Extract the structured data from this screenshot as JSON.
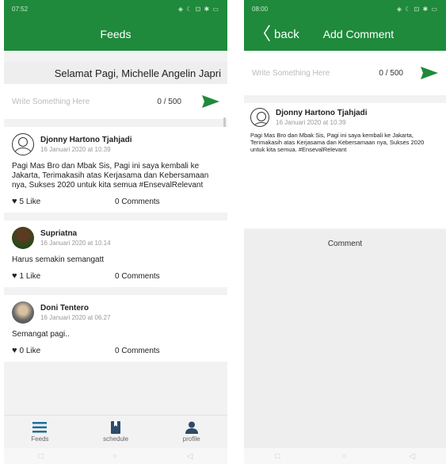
{
  "left": {
    "status_time": "07:52",
    "status_right": "◈ ☾ ⊡ ✱ ▭",
    "title": "Feeds",
    "greeting": "Selamat Pagi, Michelle Angelin Japri",
    "composer": {
      "placeholder": "Write Something Here",
      "count": "0 / 500"
    },
    "posts": [
      {
        "name": "Djonny Hartono Tjahjadi",
        "date": "16 Januari 2020 at 10.39",
        "body": "Pagi Mas Bro dan Mbak Sis, Pagi ini saya kembali ke Jakarta, Terimakasih atas Kerjasama dan Kebersamaan nya, Sukses 2020 untuk kita semua #EnsevalRelevant",
        "likes": "5 Like",
        "comments": "0 Comments"
      },
      {
        "name": "Supriatna",
        "date": "16 Januari 2020 at 10.14",
        "body": "Harus semakin semangatt",
        "likes": "1 Like",
        "comments": "0 Comments"
      },
      {
        "name": "Doni Tentero",
        "date": "16 Januari 2020 at 06.27",
        "body": "Semangat pagi..",
        "likes": "0 Like",
        "comments": "0 Comments"
      }
    ],
    "nav": [
      "Feeds",
      "schedule",
      "profile"
    ]
  },
  "right": {
    "status_time": "08:00",
    "status_right": "◈ ☾ ⊡ ✱ ▭",
    "back": "back",
    "title": "Add Comment",
    "composer": {
      "placeholder": "Write Something Here",
      "count": "0 / 500"
    },
    "post": {
      "name": "Djonny Hartono Tjahjadi",
      "date": "16 Januari 2020 at 10.39",
      "body": "Pagi Mas Bro dan Mbak Sis, Pagi ini saya kembali ke Jakarta, Terimakasih atas Kerjasama dan Kebersamaan nya, Sukses 2020 untuk kita semua. #EnsevalRelevant"
    },
    "comment_header": "Comment"
  },
  "colors": {
    "brand": "#1f8a3b",
    "send": "#1f8a3b"
  }
}
